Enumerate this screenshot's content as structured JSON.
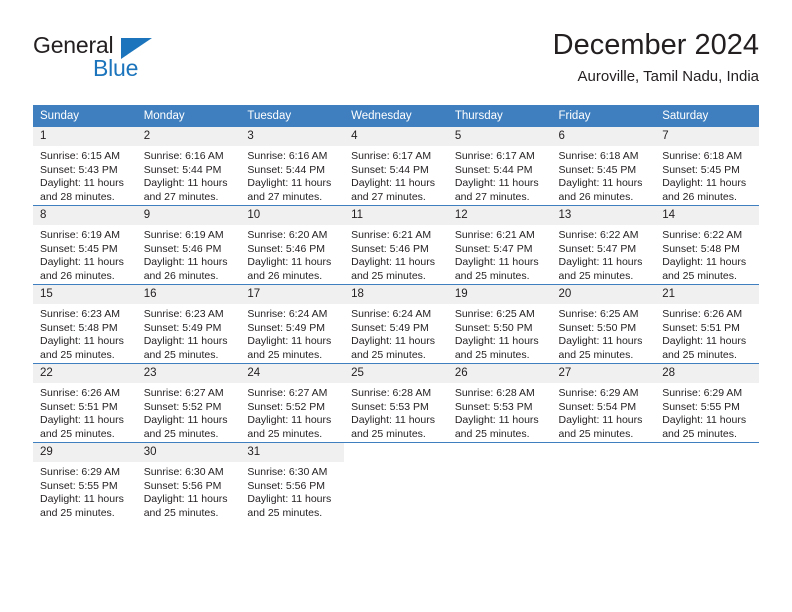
{
  "logo": {
    "text_primary": "General",
    "text_secondary": "Blue",
    "primary_color": "#231f20",
    "secondary_color": "#1c75bc",
    "triangle_icon": "triangle-icon"
  },
  "header": {
    "title": "December 2024",
    "subtitle": "Auroville, Tamil Nadu, India"
  },
  "theme": {
    "header_blue": "#3f7fbf",
    "daynum_gray": "#f0f0f0",
    "text": "#231f20"
  },
  "weekdays": [
    "Sunday",
    "Monday",
    "Tuesday",
    "Wednesday",
    "Thursday",
    "Friday",
    "Saturday"
  ],
  "labels": {
    "sunrise_prefix": "Sunrise:",
    "sunset_prefix": "Sunset:",
    "daylight_prefix": "Daylight:"
  },
  "weeks": [
    [
      {
        "day": "1",
        "sunrise": "Sunrise: 6:15 AM",
        "sunset": "Sunset: 5:43 PM",
        "daylight_line1": "Daylight: 11 hours",
        "daylight_line2": "and 28 minutes."
      },
      {
        "day": "2",
        "sunrise": "Sunrise: 6:16 AM",
        "sunset": "Sunset: 5:44 PM",
        "daylight_line1": "Daylight: 11 hours",
        "daylight_line2": "and 27 minutes."
      },
      {
        "day": "3",
        "sunrise": "Sunrise: 6:16 AM",
        "sunset": "Sunset: 5:44 PM",
        "daylight_line1": "Daylight: 11 hours",
        "daylight_line2": "and 27 minutes."
      },
      {
        "day": "4",
        "sunrise": "Sunrise: 6:17 AM",
        "sunset": "Sunset: 5:44 PM",
        "daylight_line1": "Daylight: 11 hours",
        "daylight_line2": "and 27 minutes."
      },
      {
        "day": "5",
        "sunrise": "Sunrise: 6:17 AM",
        "sunset": "Sunset: 5:44 PM",
        "daylight_line1": "Daylight: 11 hours",
        "daylight_line2": "and 27 minutes."
      },
      {
        "day": "6",
        "sunrise": "Sunrise: 6:18 AM",
        "sunset": "Sunset: 5:45 PM",
        "daylight_line1": "Daylight: 11 hours",
        "daylight_line2": "and 26 minutes."
      },
      {
        "day": "7",
        "sunrise": "Sunrise: 6:18 AM",
        "sunset": "Sunset: 5:45 PM",
        "daylight_line1": "Daylight: 11 hours",
        "daylight_line2": "and 26 minutes."
      }
    ],
    [
      {
        "day": "8",
        "sunrise": "Sunrise: 6:19 AM",
        "sunset": "Sunset: 5:45 PM",
        "daylight_line1": "Daylight: 11 hours",
        "daylight_line2": "and 26 minutes."
      },
      {
        "day": "9",
        "sunrise": "Sunrise: 6:19 AM",
        "sunset": "Sunset: 5:46 PM",
        "daylight_line1": "Daylight: 11 hours",
        "daylight_line2": "and 26 minutes."
      },
      {
        "day": "10",
        "sunrise": "Sunrise: 6:20 AM",
        "sunset": "Sunset: 5:46 PM",
        "daylight_line1": "Daylight: 11 hours",
        "daylight_line2": "and 26 minutes."
      },
      {
        "day": "11",
        "sunrise": "Sunrise: 6:21 AM",
        "sunset": "Sunset: 5:46 PM",
        "daylight_line1": "Daylight: 11 hours",
        "daylight_line2": "and 25 minutes."
      },
      {
        "day": "12",
        "sunrise": "Sunrise: 6:21 AM",
        "sunset": "Sunset: 5:47 PM",
        "daylight_line1": "Daylight: 11 hours",
        "daylight_line2": "and 25 minutes."
      },
      {
        "day": "13",
        "sunrise": "Sunrise: 6:22 AM",
        "sunset": "Sunset: 5:47 PM",
        "daylight_line1": "Daylight: 11 hours",
        "daylight_line2": "and 25 minutes."
      },
      {
        "day": "14",
        "sunrise": "Sunrise: 6:22 AM",
        "sunset": "Sunset: 5:48 PM",
        "daylight_line1": "Daylight: 11 hours",
        "daylight_line2": "and 25 minutes."
      }
    ],
    [
      {
        "day": "15",
        "sunrise": "Sunrise: 6:23 AM",
        "sunset": "Sunset: 5:48 PM",
        "daylight_line1": "Daylight: 11 hours",
        "daylight_line2": "and 25 minutes."
      },
      {
        "day": "16",
        "sunrise": "Sunrise: 6:23 AM",
        "sunset": "Sunset: 5:49 PM",
        "daylight_line1": "Daylight: 11 hours",
        "daylight_line2": "and 25 minutes."
      },
      {
        "day": "17",
        "sunrise": "Sunrise: 6:24 AM",
        "sunset": "Sunset: 5:49 PM",
        "daylight_line1": "Daylight: 11 hours",
        "daylight_line2": "and 25 minutes."
      },
      {
        "day": "18",
        "sunrise": "Sunrise: 6:24 AM",
        "sunset": "Sunset: 5:49 PM",
        "daylight_line1": "Daylight: 11 hours",
        "daylight_line2": "and 25 minutes."
      },
      {
        "day": "19",
        "sunrise": "Sunrise: 6:25 AM",
        "sunset": "Sunset: 5:50 PM",
        "daylight_line1": "Daylight: 11 hours",
        "daylight_line2": "and 25 minutes."
      },
      {
        "day": "20",
        "sunrise": "Sunrise: 6:25 AM",
        "sunset": "Sunset: 5:50 PM",
        "daylight_line1": "Daylight: 11 hours",
        "daylight_line2": "and 25 minutes."
      },
      {
        "day": "21",
        "sunrise": "Sunrise: 6:26 AM",
        "sunset": "Sunset: 5:51 PM",
        "daylight_line1": "Daylight: 11 hours",
        "daylight_line2": "and 25 minutes."
      }
    ],
    [
      {
        "day": "22",
        "sunrise": "Sunrise: 6:26 AM",
        "sunset": "Sunset: 5:51 PM",
        "daylight_line1": "Daylight: 11 hours",
        "daylight_line2": "and 25 minutes."
      },
      {
        "day": "23",
        "sunrise": "Sunrise: 6:27 AM",
        "sunset": "Sunset: 5:52 PM",
        "daylight_line1": "Daylight: 11 hours",
        "daylight_line2": "and 25 minutes."
      },
      {
        "day": "24",
        "sunrise": "Sunrise: 6:27 AM",
        "sunset": "Sunset: 5:52 PM",
        "daylight_line1": "Daylight: 11 hours",
        "daylight_line2": "and 25 minutes."
      },
      {
        "day": "25",
        "sunrise": "Sunrise: 6:28 AM",
        "sunset": "Sunset: 5:53 PM",
        "daylight_line1": "Daylight: 11 hours",
        "daylight_line2": "and 25 minutes."
      },
      {
        "day": "26",
        "sunrise": "Sunrise: 6:28 AM",
        "sunset": "Sunset: 5:53 PM",
        "daylight_line1": "Daylight: 11 hours",
        "daylight_line2": "and 25 minutes."
      },
      {
        "day": "27",
        "sunrise": "Sunrise: 6:29 AM",
        "sunset": "Sunset: 5:54 PM",
        "daylight_line1": "Daylight: 11 hours",
        "daylight_line2": "and 25 minutes."
      },
      {
        "day": "28",
        "sunrise": "Sunrise: 6:29 AM",
        "sunset": "Sunset: 5:55 PM",
        "daylight_line1": "Daylight: 11 hours",
        "daylight_line2": "and 25 minutes."
      }
    ],
    [
      {
        "day": "29",
        "sunrise": "Sunrise: 6:29 AM",
        "sunset": "Sunset: 5:55 PM",
        "daylight_line1": "Daylight: 11 hours",
        "daylight_line2": "and 25 minutes."
      },
      {
        "day": "30",
        "sunrise": "Sunrise: 6:30 AM",
        "sunset": "Sunset: 5:56 PM",
        "daylight_line1": "Daylight: 11 hours",
        "daylight_line2": "and 25 minutes."
      },
      {
        "day": "31",
        "sunrise": "Sunrise: 6:30 AM",
        "sunset": "Sunset: 5:56 PM",
        "daylight_line1": "Daylight: 11 hours",
        "daylight_line2": "and 25 minutes."
      },
      {
        "day": "",
        "sunrise": "",
        "sunset": "",
        "daylight_line1": "",
        "daylight_line2": ""
      },
      {
        "day": "",
        "sunrise": "",
        "sunset": "",
        "daylight_line1": "",
        "daylight_line2": ""
      },
      {
        "day": "",
        "sunrise": "",
        "sunset": "",
        "daylight_line1": "",
        "daylight_line2": ""
      },
      {
        "day": "",
        "sunrise": "",
        "sunset": "",
        "daylight_line1": "",
        "daylight_line2": ""
      }
    ]
  ]
}
